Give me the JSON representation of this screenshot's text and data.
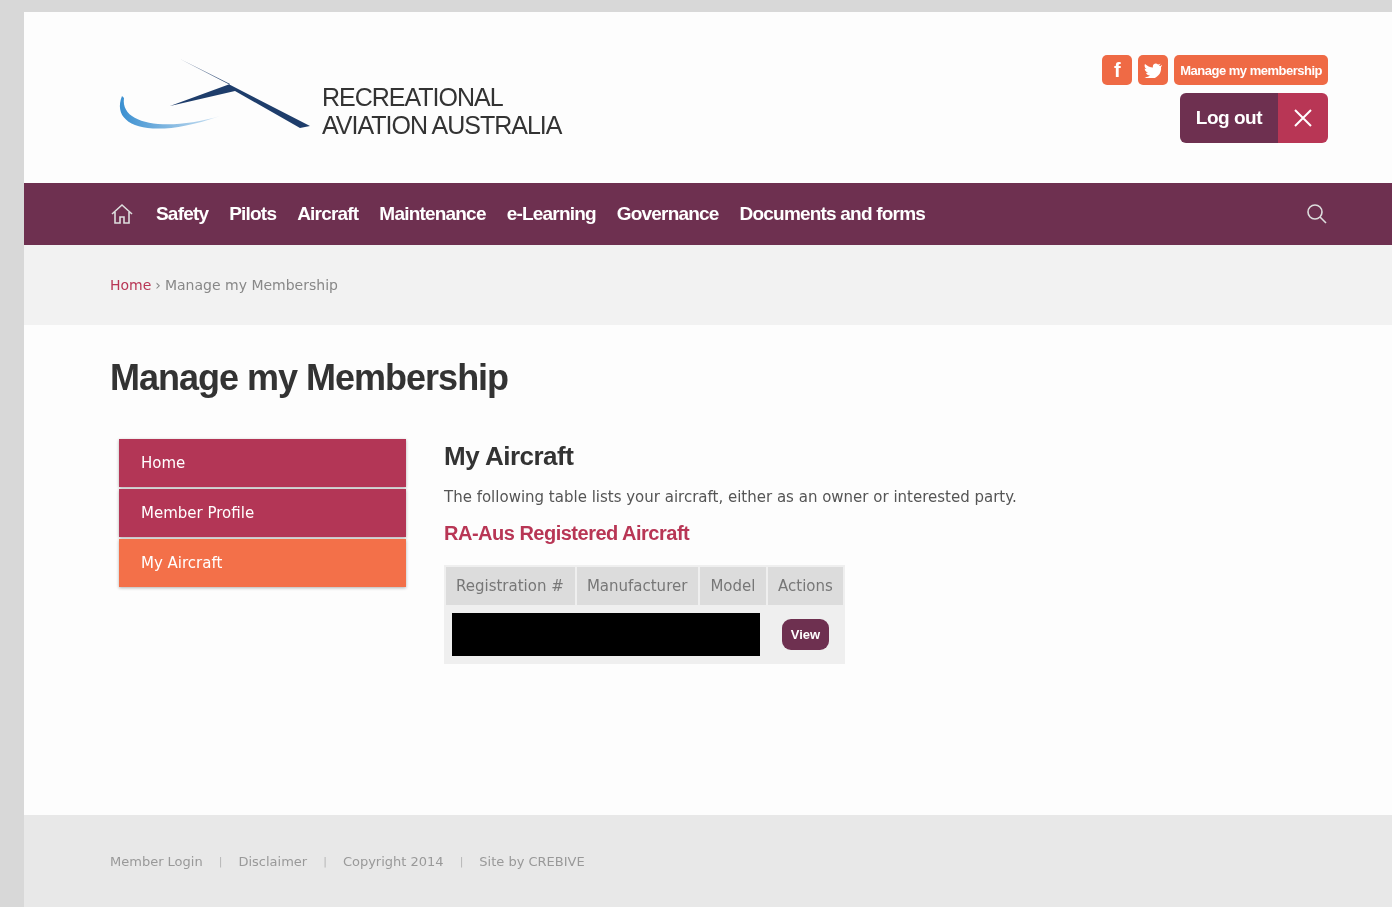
{
  "header": {
    "logo_text": [
      "RECREATIONAL",
      "AVIATION AUSTRALIA"
    ],
    "social": [
      {
        "kind": "facebook",
        "label": "f"
      },
      {
        "kind": "twitter"
      }
    ],
    "membership_button": "Manage my membership",
    "logout_button": "Log out"
  },
  "nav": {
    "items": [
      "Safety",
      "Pilots",
      "Aircraft",
      "Maintenance",
      "e-Learning",
      "Governance",
      "Documents and forms"
    ]
  },
  "breadcrumb": {
    "home": "Home",
    "separator": "›",
    "current": "Manage my Membership"
  },
  "page_title": "Manage my Membership",
  "sidebar": {
    "items": [
      {
        "label": "Home",
        "selected": false
      },
      {
        "label": "Member Profile",
        "selected": false
      },
      {
        "label": "My Aircraft",
        "selected": true
      }
    ]
  },
  "content": {
    "heading": "My Aircraft",
    "intro": "The following table lists your aircraft, either as an owner or interested party.",
    "subheading": "RA-Aus Registered Aircraft",
    "table": {
      "columns": [
        "Registration #",
        "Manufacturer",
        "Model",
        "Actions"
      ],
      "rows": [
        {
          "redacted": true,
          "action": "View"
        }
      ]
    }
  },
  "footer": {
    "items": [
      {
        "kind": "link",
        "text": "Member Login"
      },
      {
        "kind": "separator",
        "text": "|"
      },
      {
        "kind": "link",
        "text": "Disclaimer"
      },
      {
        "kind": "separator",
        "text": "|"
      },
      {
        "kind": "link",
        "text": "Copyright 2014"
      },
      {
        "kind": "separator",
        "text": "|"
      },
      {
        "kind": "link",
        "text": "Site by CREBIVE"
      }
    ]
  }
}
